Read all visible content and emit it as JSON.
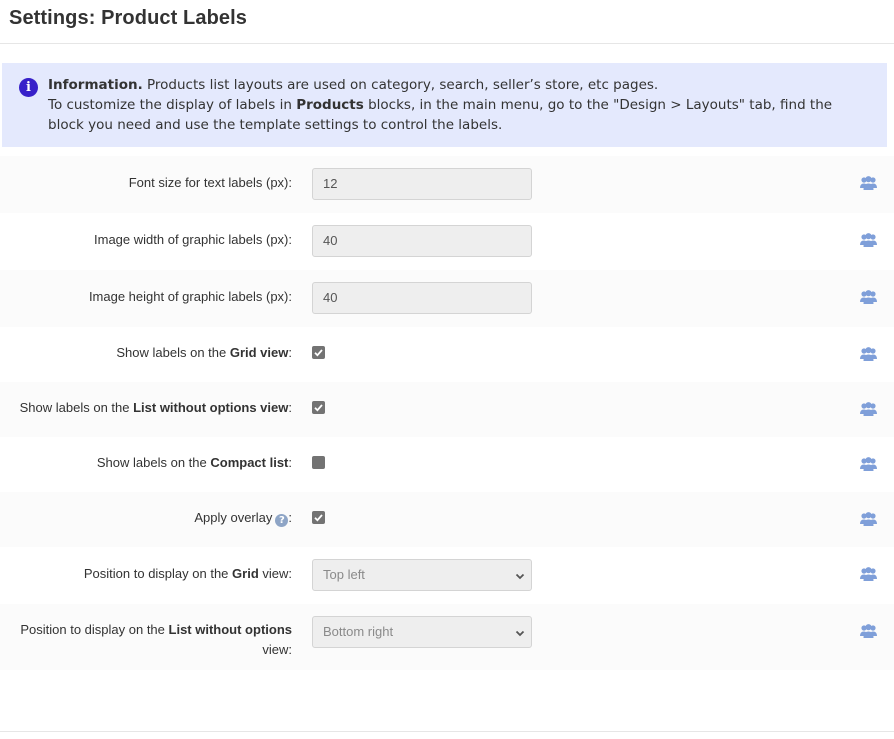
{
  "header": {
    "title": "Settings: Product Labels"
  },
  "info": {
    "icon": "info-icon",
    "title": "Information.",
    "line1": " Products list layouts are used on category, search, seller’s store, etc pages.",
    "line2_pre": "To customize the display of labels in ",
    "line2_bold": "Products",
    "line2_post": " blocks, in the main menu, go to the \"Design > Layouts\" tab, find the block you need and use the template settings to control the labels."
  },
  "settings": {
    "font_size": {
      "label": "Font size for text labels (px):",
      "value": "12"
    },
    "image_width": {
      "label": "Image width of graphic labels (px):",
      "value": "40"
    },
    "image_height": {
      "label": "Image height of graphic labels (px):",
      "value": "40"
    },
    "show_grid": {
      "label_pre": "Show labels on the ",
      "label_bold": "Grid view",
      "label_post": ":",
      "checked": true
    },
    "show_list": {
      "label_pre": "Show labels on the ",
      "label_bold": "List without options view",
      "label_post": ":",
      "checked": true
    },
    "show_compact": {
      "label_pre": "Show labels on the ",
      "label_bold": "Compact list",
      "label_post": ":",
      "checked": false
    },
    "apply_overlay": {
      "label": "Apply overlay",
      "help_glyph": "?",
      "label_post": ":",
      "checked": true
    },
    "position_grid": {
      "label_pre": "Position to display on the ",
      "label_bold": "Grid",
      "label_post": " view:",
      "value": "Top left"
    },
    "position_list": {
      "label_pre": "Position to display on the ",
      "label_bold": "List without options",
      "label_post": " view:",
      "value": "Bottom right"
    }
  },
  "icons": {
    "share": "users-icon",
    "help": "question-circle-icon"
  },
  "colors": {
    "info_bg": "#e4e9fd",
    "info_icon": "#3720c9",
    "users_icon": "#7f9fd9",
    "checkbox": "#737373"
  }
}
